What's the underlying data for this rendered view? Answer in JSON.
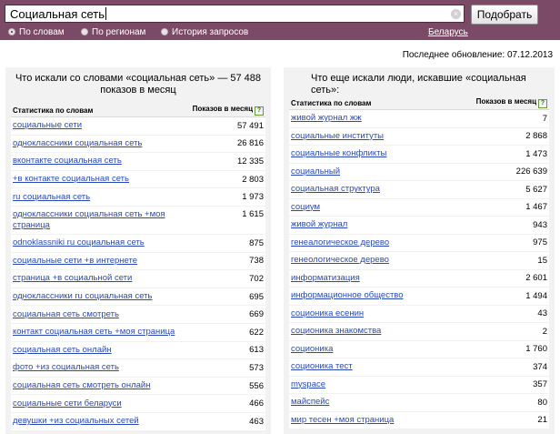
{
  "search": {
    "value": "Социальная сеть",
    "submit_label": "Подобрать",
    "clear_glyph": "×"
  },
  "modes": [
    {
      "label": "По словам",
      "selected": true
    },
    {
      "label": "По регионам",
      "selected": false
    },
    {
      "label": "История запросов",
      "selected": false
    }
  ],
  "region": "Беларусь",
  "last_update": "Последнее обновление: 07.12.2013",
  "icons": {
    "help": "?"
  },
  "left": {
    "title": "Что искали со словами «социальная сеть» — 57 488 показов в месяц",
    "col_phrase": "Статистика по словам",
    "col_count": "Показов в месяц",
    "rows": [
      {
        "phrase": "социальные сети",
        "count": "57 491"
      },
      {
        "phrase": "одноклассники социальная сеть",
        "count": "26 816"
      },
      {
        "phrase": "вконтакте социальная сеть",
        "count": "12 335"
      },
      {
        "phrase": "+в контакте социальная сеть",
        "count": "2 803"
      },
      {
        "phrase": "ru социальная сеть",
        "count": "1 973"
      },
      {
        "phrase": "одноклассники социальная сеть +моя страница",
        "count": "1 615"
      },
      {
        "phrase": "odnoklassniki ru социальная сеть",
        "count": "875"
      },
      {
        "phrase": "социальные сети +в интернете",
        "count": "738"
      },
      {
        "phrase": "страница +в социальной сети",
        "count": "702"
      },
      {
        "phrase": "одноклассники ru социальная сеть",
        "count": "695"
      },
      {
        "phrase": "социальная сеть смотреть",
        "count": "669"
      },
      {
        "phrase": "контакт социальная сеть +моя страница",
        "count": "622"
      },
      {
        "phrase": "социальная сеть онлайн",
        "count": "613"
      },
      {
        "phrase": "фото +из социальная сеть",
        "count": "573"
      },
      {
        "phrase": "социальная сеть смотреть онлайн",
        "count": "556"
      },
      {
        "phrase": "социальные сети беларуси",
        "count": "466"
      },
      {
        "phrase": "девушки +из социальных сетей",
        "count": "463"
      }
    ]
  },
  "right": {
    "title": "Что еще искали люди, искавшие «социальная сеть»:",
    "col_phrase": "Статистика по словам",
    "col_count": "Показов в месяц",
    "rows": [
      {
        "phrase": "живой журнал жж",
        "count": "7"
      },
      {
        "phrase": "социальные институты",
        "count": "2 868"
      },
      {
        "phrase": "социальные конфликты",
        "count": "1 473"
      },
      {
        "phrase": "социальный",
        "count": "226 639"
      },
      {
        "phrase": "социальная структура",
        "count": "5 627"
      },
      {
        "phrase": "социум",
        "count": "1 467"
      },
      {
        "phrase": "живой журнал",
        "count": "943"
      },
      {
        "phrase": "генеалогическое дерево",
        "count": "975"
      },
      {
        "phrase": "генеологическое дерево",
        "count": "15"
      },
      {
        "phrase": "информатизация",
        "count": "2 601"
      },
      {
        "phrase": "информационное общество",
        "count": "1 494"
      },
      {
        "phrase": "соционика есенин",
        "count": "43"
      },
      {
        "phrase": "соционика знакомства",
        "count": "2"
      },
      {
        "phrase": "соционика",
        "count": "1 760"
      },
      {
        "phrase": "соционика тест",
        "count": "374"
      },
      {
        "phrase": "myspace",
        "count": "357"
      },
      {
        "phrase": "майспейс",
        "count": "80"
      },
      {
        "phrase": "мир тесен +моя страница",
        "count": "21"
      }
    ]
  }
}
